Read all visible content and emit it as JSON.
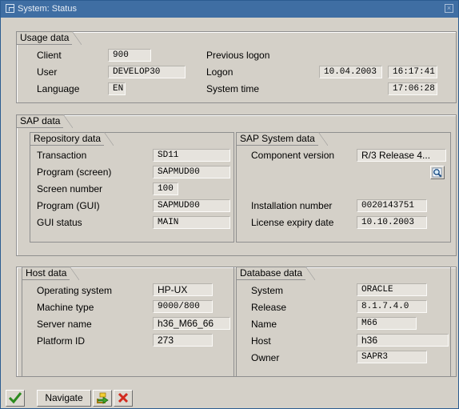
{
  "window": {
    "title": "System: Status"
  },
  "usage": {
    "title": "Usage data",
    "client_label": "Client",
    "client": "900",
    "user_label": "User",
    "user": "DEVELOP30",
    "language_label": "Language",
    "language": "EN",
    "previous_logon_label": "Previous logon",
    "logon_label": "Logon",
    "logon_date": "10.04.2003",
    "logon_time": "16:17:41",
    "system_time_label": "System time",
    "system_time": "17:06:28"
  },
  "sap": {
    "title": "SAP data",
    "repository": {
      "title": "Repository data",
      "rows": [
        {
          "label": "Transaction",
          "value": "SD11"
        },
        {
          "label": "Program (screen)",
          "value": "SAPMUD00"
        },
        {
          "label": "Screen number",
          "value": "100"
        },
        {
          "label": "Program (GUI)",
          "value": "SAPMUD00"
        },
        {
          "label": "GUI status",
          "value": "MAIN"
        }
      ]
    },
    "system": {
      "title": "SAP System data",
      "component_label": "Component version",
      "component": "R/3 Release 4...",
      "installation_label": "Installation number",
      "installation": "0020143751",
      "license_label": "License expiry date",
      "license": "10.10.2003"
    }
  },
  "host": {
    "title": "Host data",
    "rows": [
      {
        "label": "Operating system",
        "value": "HP-UX"
      },
      {
        "label": "Machine type",
        "value": "9000/800"
      },
      {
        "label": "Server name",
        "value": "h36_M66_66"
      },
      {
        "label": "Platform ID",
        "value": "273"
      }
    ]
  },
  "database": {
    "title": "Database data",
    "rows": [
      {
        "label": "System",
        "value": "ORACLE"
      },
      {
        "label": "Release",
        "value": "8.1.7.4.0"
      },
      {
        "label": "Name",
        "value": "M66"
      },
      {
        "label": "Host",
        "value": "h36"
      },
      {
        "label": "Owner",
        "value": "SAPR3"
      }
    ]
  },
  "toolbar": {
    "navigate_label": "Navigate"
  },
  "icons": {
    "ok": "checkmark-icon",
    "export": "export-icon",
    "cancel": "cancel-icon",
    "details": "magnifier-icon"
  }
}
